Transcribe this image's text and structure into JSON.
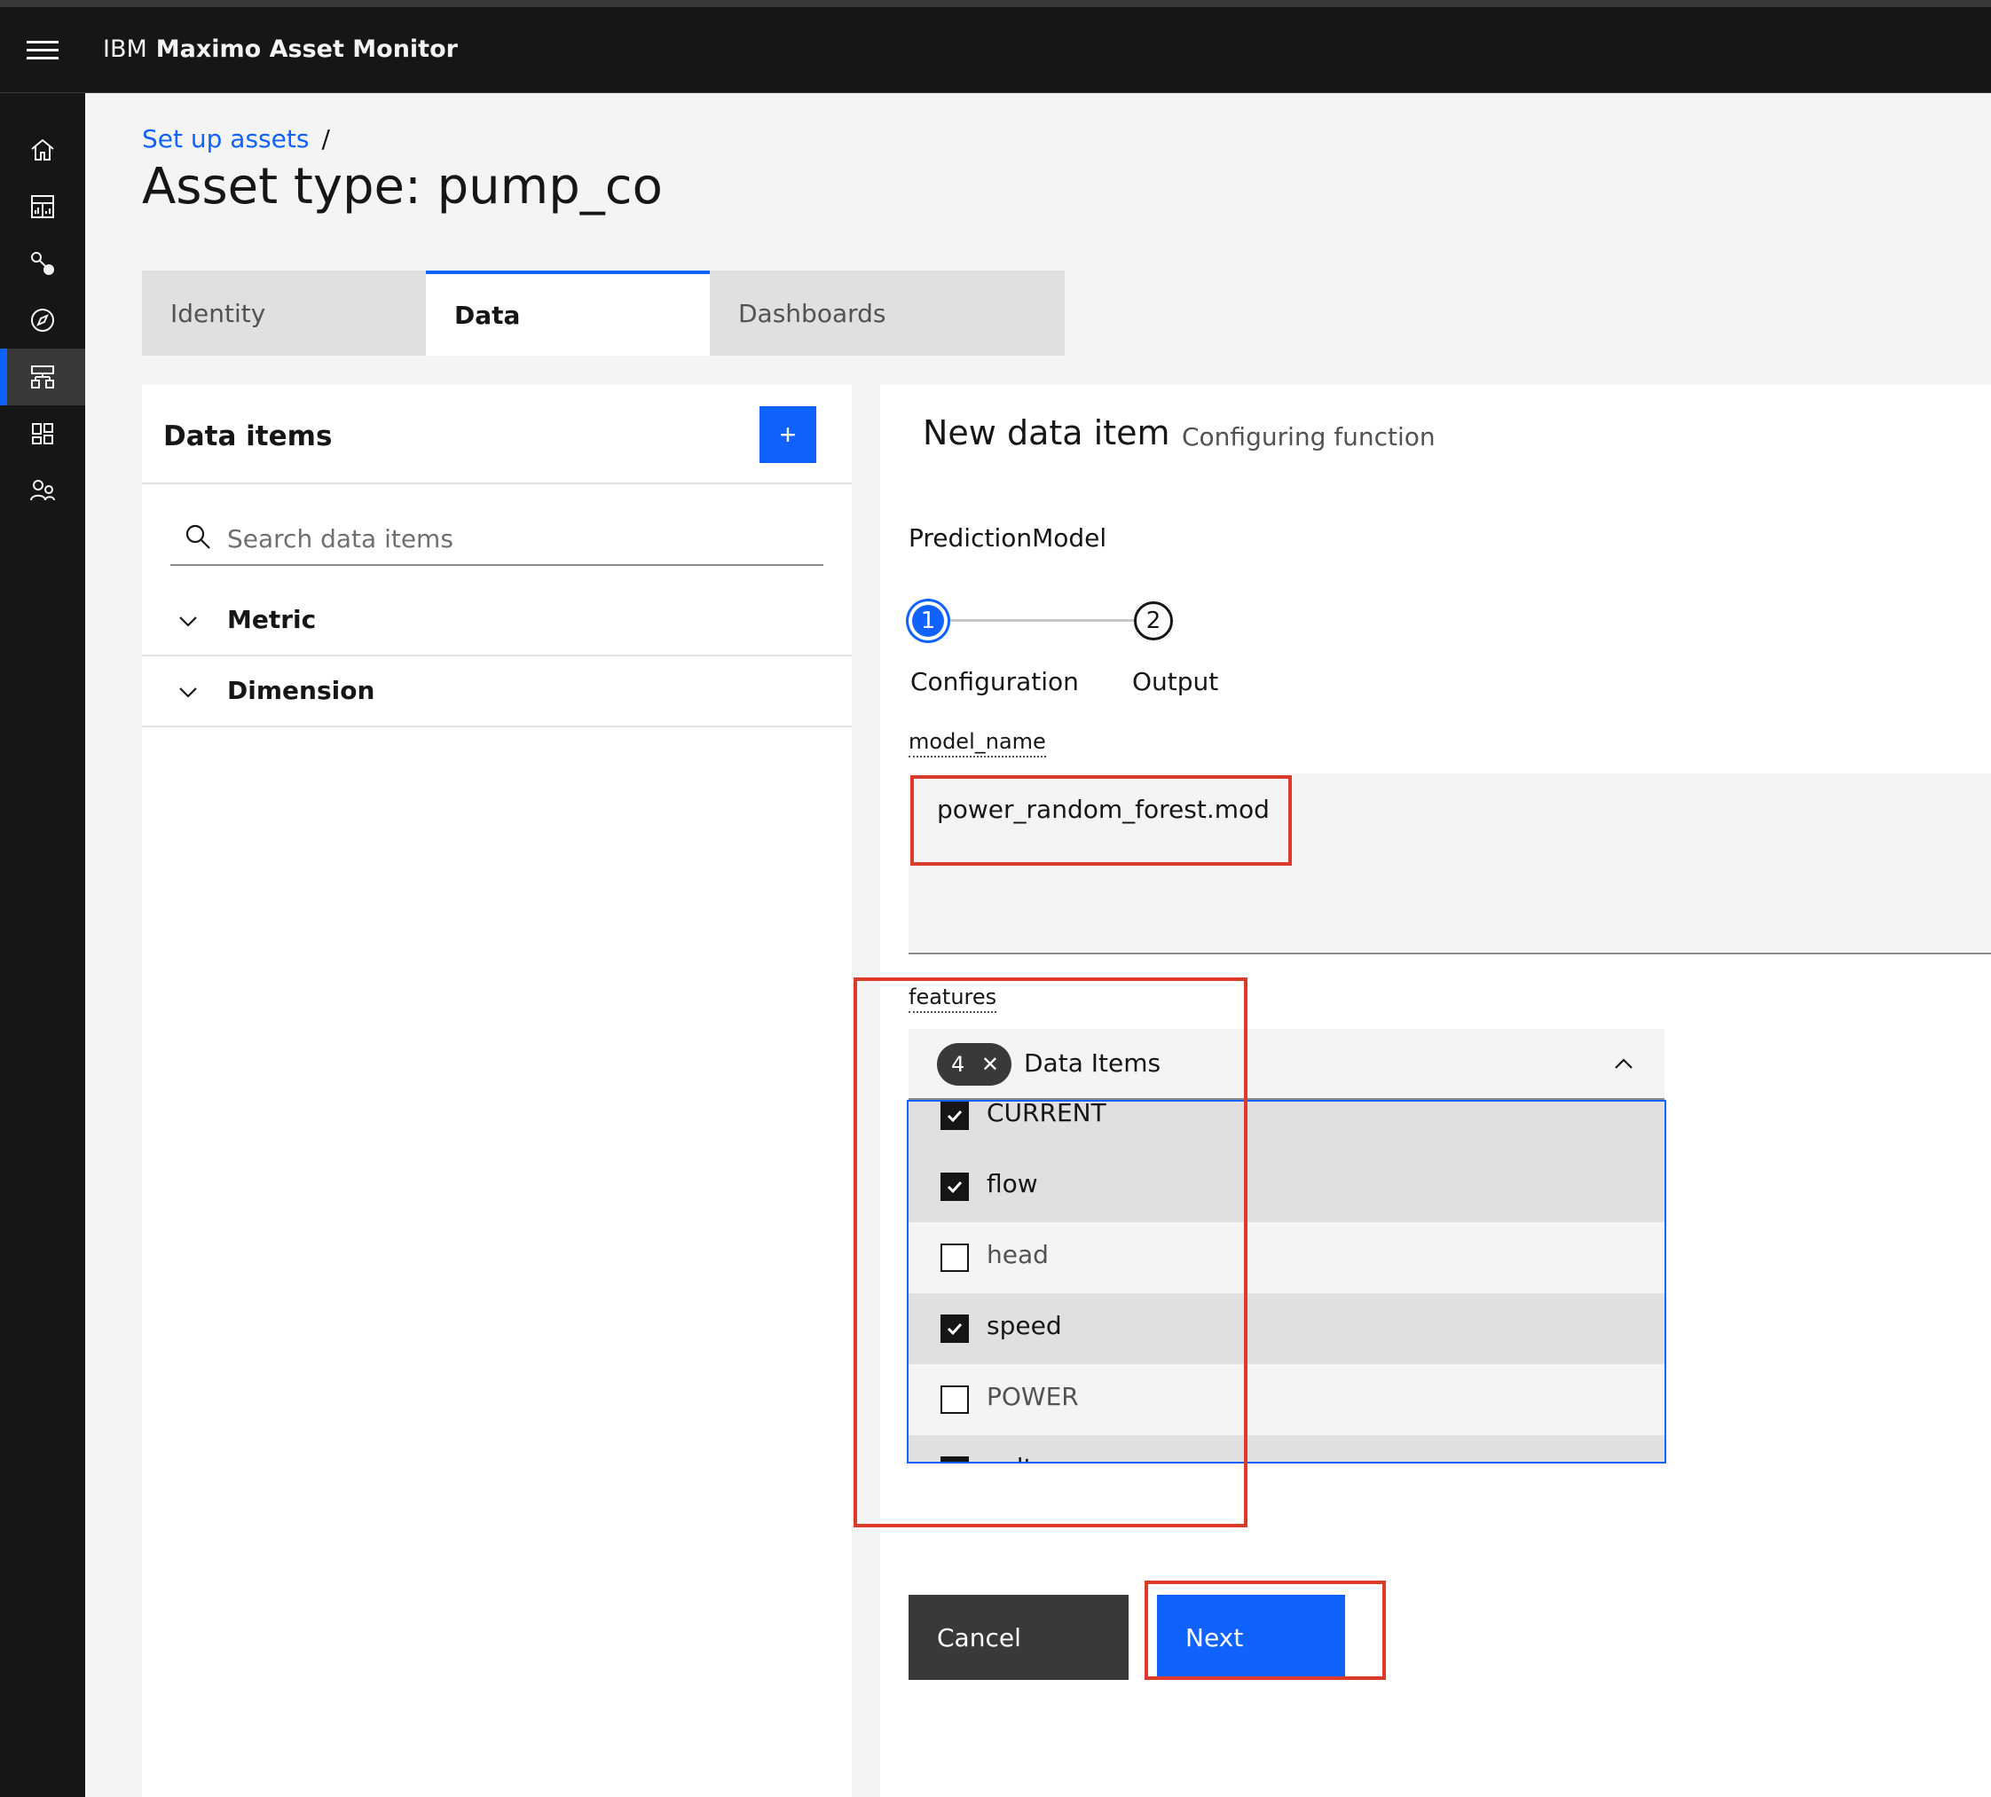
{
  "header": {
    "brand_prefix": "IBM",
    "product": "Maximo Asset Monitor"
  },
  "sidenav": {
    "items": [
      {
        "name": "home-icon"
      },
      {
        "name": "dashboard-icon"
      },
      {
        "name": "connect-icon"
      },
      {
        "name": "explore-icon"
      },
      {
        "name": "setup-assets-icon",
        "active": true
      },
      {
        "name": "services-icon"
      },
      {
        "name": "users-icon"
      }
    ]
  },
  "breadcrumb": {
    "link": "Set up assets",
    "separator": "/"
  },
  "page": {
    "title": "Asset type: pump_co"
  },
  "tabs": [
    {
      "label": "Identity"
    },
    {
      "label": "Data",
      "active": true
    },
    {
      "label": "Dashboards"
    }
  ],
  "left_panel": {
    "title": "Data items",
    "add_label": "+",
    "search_placeholder": "Search data items",
    "groups": [
      "Metric",
      "Dimension"
    ]
  },
  "right_panel": {
    "title": "New data item",
    "subtitle": "Configuring function",
    "function_name": "PredictionModel",
    "steps": [
      {
        "number": "1",
        "label": "Configuration",
        "current": true
      },
      {
        "number": "2",
        "label": "Output",
        "current": false
      }
    ],
    "model_name": {
      "label": "model_name",
      "value": "power_random_forest.mod"
    },
    "features": {
      "label": "features",
      "selected_count": "4",
      "clear_label": "✕",
      "field_label": "Data Items",
      "options": [
        {
          "label": "CURRENT",
          "checked": true
        },
        {
          "label": "flow",
          "checked": true
        },
        {
          "label": "head",
          "checked": false
        },
        {
          "label": "speed",
          "checked": true
        },
        {
          "label": "POWER",
          "checked": false
        },
        {
          "label": "voltage",
          "checked": true
        }
      ]
    },
    "buttons": {
      "cancel": "Cancel",
      "next": "Next"
    }
  },
  "colors": {
    "accent": "#0f62fe",
    "header_bg": "#161616",
    "annotation": "#da3b2a"
  }
}
